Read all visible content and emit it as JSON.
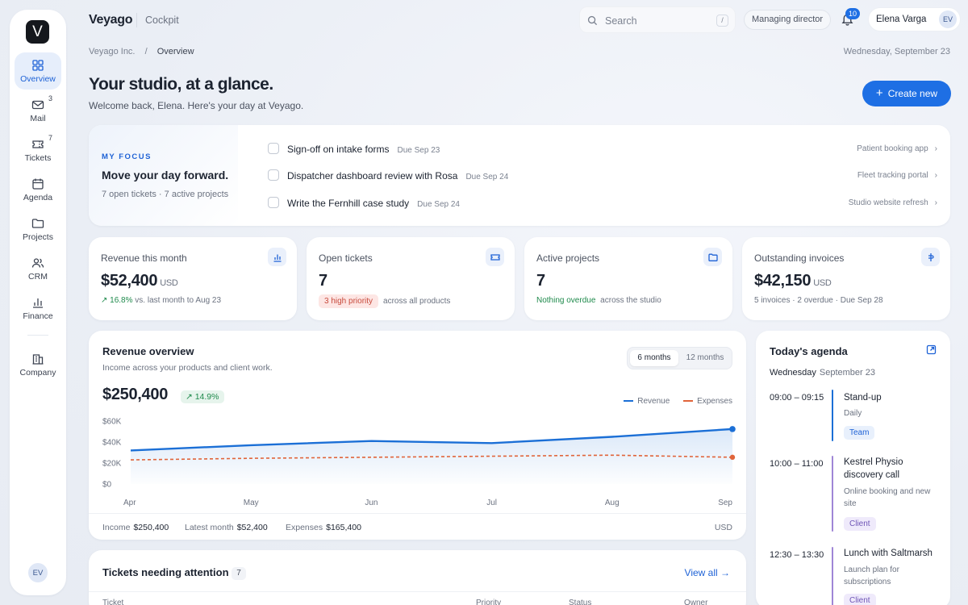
{
  "app": {
    "logo_letter": "V",
    "brand": "Veyago",
    "section": "Cockpit"
  },
  "sidebar": {
    "items": [
      {
        "label": "Overview",
        "icon": "grid-icon",
        "active": true
      },
      {
        "label": "Mail",
        "icon": "mail-icon",
        "badge": "3"
      },
      {
        "label": "Tickets",
        "icon": "ticket-icon",
        "badge": "7"
      },
      {
        "label": "Agenda",
        "icon": "calendar-icon"
      },
      {
        "label": "Projects",
        "icon": "folder-icon"
      },
      {
        "label": "CRM",
        "icon": "users-icon"
      },
      {
        "label": "Finance",
        "icon": "bar-chart-icon"
      },
      {
        "label": "Company",
        "icon": "building-icon"
      }
    ],
    "avatar": "EV"
  },
  "header": {
    "search_placeholder": "Search",
    "search_shortcut": "/",
    "role": "Managing director",
    "notifications": "10",
    "user_name": "Elena Varga",
    "user_initials": "EV"
  },
  "breadcrumb": {
    "root": "Veyago Inc.",
    "sep": "/",
    "current": "Overview"
  },
  "date": "Wednesday, September 23",
  "page": {
    "title": "Your studio, at a glance.",
    "welcome": "Welcome back, Elena. Here's your day at Veyago.",
    "create_label": "Create new"
  },
  "focus": {
    "tag": "MY FOCUS",
    "title": "Move your day forward.",
    "subtitle": "7 open tickets · 7 active projects",
    "tasks": [
      {
        "title": "Sign-off on intake forms",
        "due": "Due Sep 23",
        "project": "Patient booking app"
      },
      {
        "title": "Dispatcher dashboard review with Rosa",
        "due": "Due Sep 24",
        "project": "Fleet tracking portal"
      },
      {
        "title": "Write the Fernhill case study",
        "due": "Due Sep 24",
        "project": "Studio website refresh"
      }
    ]
  },
  "kpis": [
    {
      "label": "Revenue this month",
      "value": "$52,400",
      "unit": "USD",
      "delta": "↗ 16.8%",
      "note": "vs. last month to Aug 23"
    },
    {
      "label": "Open tickets",
      "value": "7",
      "pill": "3 high priority",
      "note": "across all products"
    },
    {
      "label": "Active projects",
      "value": "7",
      "status": "Nothing overdue",
      "note": "across the studio"
    },
    {
      "label": "Outstanding invoices",
      "value": "$42,150",
      "unit": "USD",
      "note": "5 invoices · 2 overdue · Due Sep 28"
    }
  ],
  "revenue": {
    "title": "Revenue overview",
    "subtitle": "Income across your products and client work.",
    "range_6": "6 months",
    "range_12": "12 months",
    "total": "$250,400",
    "delta": "↗ 14.9%",
    "foot": {
      "income_label": "Income",
      "income": "$250,400",
      "latest_label": "Latest month",
      "latest": "$52,400",
      "expenses_label": "Expenses",
      "expenses": "$165,400",
      "currency": "USD"
    }
  },
  "chart_data": {
    "type": "line",
    "categories": [
      "Apr",
      "May",
      "Jun",
      "Jul",
      "Aug",
      "Sep"
    ],
    "ylim": [
      0,
      60000
    ],
    "yticks": [
      "$0",
      "$20K",
      "$40K",
      "$60K"
    ],
    "series": [
      {
        "name": "Revenue",
        "values": [
          32000,
          37000,
          41000,
          39000,
          45000,
          52400
        ],
        "color": "#1b6fd6"
      },
      {
        "name": "Expenses",
        "values": [
          23000,
          24500,
          25500,
          26500,
          27500,
          25500
        ],
        "color": "#e0643a"
      }
    ],
    "legend": "top-right",
    "grid": false
  },
  "agenda": {
    "title": "Today's agenda",
    "day": "Wednesday",
    "date": "September 23",
    "events": [
      {
        "time": "09:00 – 09:15",
        "name": "Stand-up",
        "desc": "Daily",
        "tag": "Team",
        "color": "#1b6fd6"
      },
      {
        "time": "10:00 – 11:00",
        "name": "Kestrel Physio discovery call",
        "desc": "Online booking and new site",
        "tag": "Client",
        "color": "#9f86d6"
      },
      {
        "time": "12:30 – 13:30",
        "name": "Lunch with Saltmarsh",
        "desc": "Launch plan for subscriptions",
        "tag": "Client",
        "color": "#9f86d6"
      }
    ]
  },
  "tickets": {
    "title": "Tickets needing attention",
    "count": "7",
    "view_all": "View all →",
    "columns": [
      "Ticket",
      "Priority",
      "Status",
      "Owner"
    ]
  }
}
